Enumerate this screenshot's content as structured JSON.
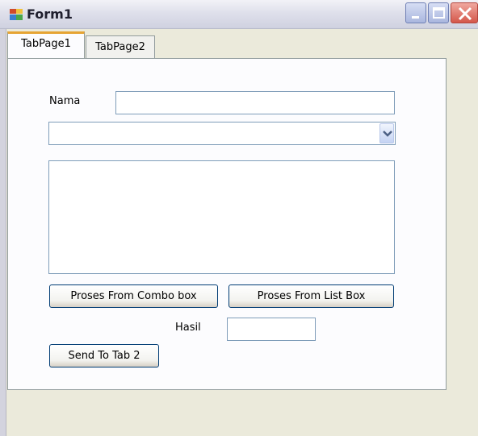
{
  "window": {
    "title": "Form1",
    "icon": "form-icon",
    "controls": {
      "minimize": "minimize-icon",
      "maximize": "maximize-icon",
      "close": "close-icon"
    }
  },
  "tabs": [
    {
      "label": "TabPage1",
      "active": true
    },
    {
      "label": "TabPage2",
      "active": false
    }
  ],
  "form": {
    "nama_label": "Nama",
    "nama_value": "",
    "combo_value": "",
    "listbox_items": [],
    "button_combo": "Proses From Combo box",
    "button_list": "Proses From List Box",
    "hasil_label": "Hasil",
    "hasil_value": "",
    "button_send": "Send To Tab 2"
  },
  "colors": {
    "tab_highlight": "#e6a433",
    "field_border": "#7f9db9",
    "button_border": "#003c74"
  }
}
